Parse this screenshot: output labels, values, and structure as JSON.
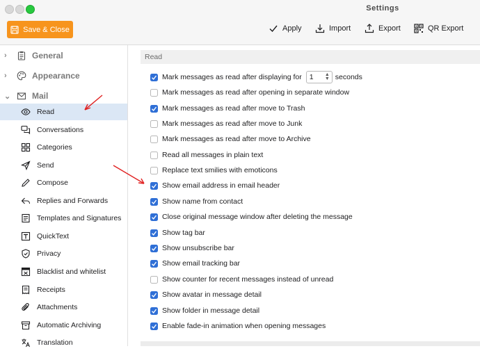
{
  "window": {
    "title": "Settings"
  },
  "toolbar": {
    "save_close": "Save & Close",
    "apply": "Apply",
    "import": "Import",
    "export": "Export",
    "qr_export": "QR Export"
  },
  "sidebar": {
    "groups": [
      {
        "label": "General",
        "icon": "clipboard-icon",
        "expanded": false
      },
      {
        "label": "Appearance",
        "icon": "palette-icon",
        "expanded": false
      },
      {
        "label": "Mail",
        "icon": "envelope-icon",
        "expanded": true
      }
    ],
    "mail_items": [
      {
        "label": "Read",
        "icon": "eye-icon",
        "active": true
      },
      {
        "label": "Conversations",
        "icon": "chat-bubbles-icon"
      },
      {
        "label": "Categories",
        "icon": "grid-icon"
      },
      {
        "label": "Send",
        "icon": "paper-plane-icon"
      },
      {
        "label": "Compose",
        "icon": "pencil-icon"
      },
      {
        "label": "Replies and Forwards",
        "icon": "reply-icon"
      },
      {
        "label": "Templates and Signatures",
        "icon": "templates-icon"
      },
      {
        "label": "QuickText",
        "icon": "quicktext-icon"
      },
      {
        "label": "Privacy",
        "icon": "shield-icon"
      },
      {
        "label": "Blacklist and whitelist",
        "icon": "blacklist-icon"
      },
      {
        "label": "Receipts",
        "icon": "receipt-icon"
      },
      {
        "label": "Attachments",
        "icon": "paperclip-icon"
      },
      {
        "label": "Automatic Archiving",
        "icon": "archive-icon"
      },
      {
        "label": "Translation",
        "icon": "translate-icon"
      }
    ]
  },
  "content": {
    "section_title": "Read",
    "stepper_value": "1",
    "stepper_suffix": "seconds",
    "options": [
      {
        "label": "Mark messages as read after displaying for",
        "checked": true
      },
      {
        "label": "Mark messages as read after opening in separate window",
        "checked": false
      },
      {
        "label": "Mark messages as read after move to Trash",
        "checked": true
      },
      {
        "label": "Mark messages as read after move to Junk",
        "checked": false
      },
      {
        "label": "Mark messages as read after move to Archive",
        "checked": false
      },
      {
        "label": "Read all messages in plain text",
        "checked": false
      },
      {
        "label": "Replace text smilies with emoticons",
        "checked": false
      },
      {
        "label": "Show email address in email header",
        "checked": true
      },
      {
        "label": "Show name from contact",
        "checked": true
      },
      {
        "label": "Close original message window after deleting the message",
        "checked": true
      },
      {
        "label": "Show tag bar",
        "checked": true
      },
      {
        "label": "Show unsubscribe bar",
        "checked": true
      },
      {
        "label": "Show email tracking bar",
        "checked": true
      },
      {
        "label": "Show counter for recent messages instead of unread",
        "checked": false
      },
      {
        "label": "Show avatar in message detail",
        "checked": true
      },
      {
        "label": "Show folder in message detail",
        "checked": true
      },
      {
        "label": "Enable fade-in animation when opening messages",
        "checked": true
      }
    ]
  },
  "colors": {
    "accent_orange": "#f7941d",
    "checkbox_blue": "#2f6fd6",
    "selection": "#dbe7f5",
    "annotation_red": "#e02020"
  }
}
